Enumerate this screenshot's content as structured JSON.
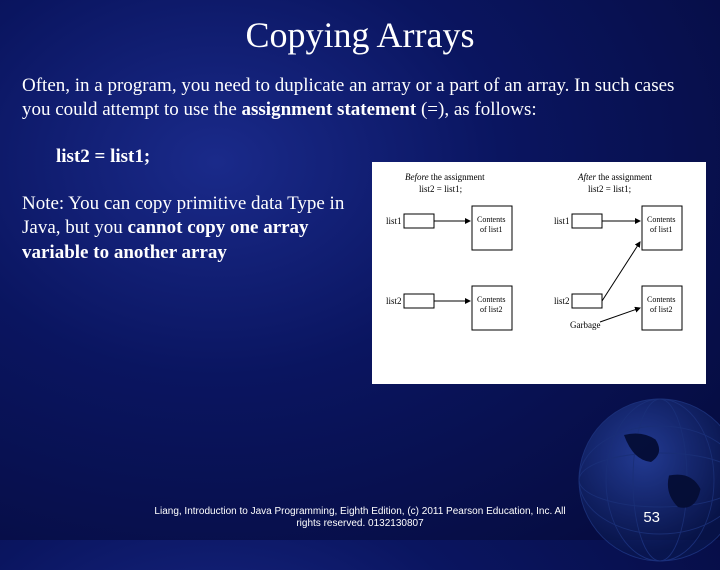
{
  "title": "Copying Arrays",
  "para1_a": "Often, in a program, you need to duplicate an array or a part of an array. In such cases you could attempt to use the ",
  "para1_b": "assignment statement ",
  "para1_c": "(=), as follows:",
  "code": "list2 = list1;",
  "note_a": "Note: You can copy primitive data Type in Java, but you ",
  "note_b": "cannot copy one array variable to another array",
  "diagram": {
    "before_label_a": "Before",
    "before_label_b": " the assignment",
    "after_label_a": "After",
    "after_label_b": " the assignment",
    "stmt": "list2 = list1;",
    "list1": "list1",
    "list2": "list2",
    "contents1": "Contents",
    "contents1b": "of list1",
    "contents2": "Contents",
    "contents2b": "of list2",
    "garbage": "Garbage"
  },
  "footer_a": "Liang, Introduction to Java Programming, Eighth Edition, (c) 2011 Pearson Education, Inc. All",
  "footer_b": "rights reserved. 0132130807",
  "page": "53"
}
